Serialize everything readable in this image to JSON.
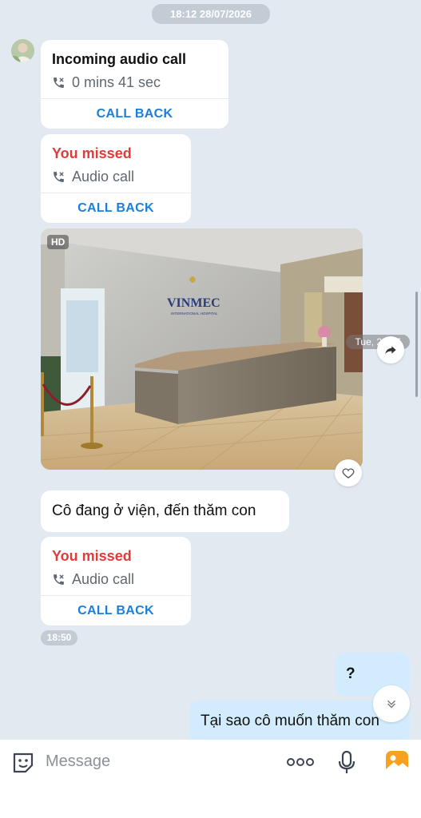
{
  "timestamps": {
    "top": "18:12 28/07/2026",
    "mid": "18:50"
  },
  "messages": {
    "call1": {
      "title": "Incoming audio call",
      "sub": "0 mins 41 sec",
      "action": "CALL BACK"
    },
    "call2": {
      "title": "You missed",
      "sub": "Audio call",
      "action": "CALL BACK"
    },
    "photo": {
      "badge": "HD",
      "date_hint": "Tue, 28/07",
      "sign_line1": "VINMEC",
      "sign_line2": "INTERNATIONAL HOSPITAL"
    },
    "text1": "Cô đang ở viện, đến thăm con",
    "call3": {
      "title": "You missed",
      "sub": "Audio call",
      "action": "CALL BACK"
    },
    "mine1": "?",
    "mine2": "Tại sao cô muốn thăm con"
  },
  "composer": {
    "placeholder": "Message"
  },
  "icons": {
    "sticker": "sticker-icon",
    "more": "more-icon",
    "mic": "microphone-icon",
    "gallery": "gallery-icon",
    "share": "share-icon",
    "like": "heart-icon",
    "scroll": "chevron-down-icon"
  },
  "colors": {
    "accent": "#1a7fdc",
    "missed": "#e13a3a",
    "background": "#e2e9f1",
    "my_bubble": "#d2ecfd"
  }
}
